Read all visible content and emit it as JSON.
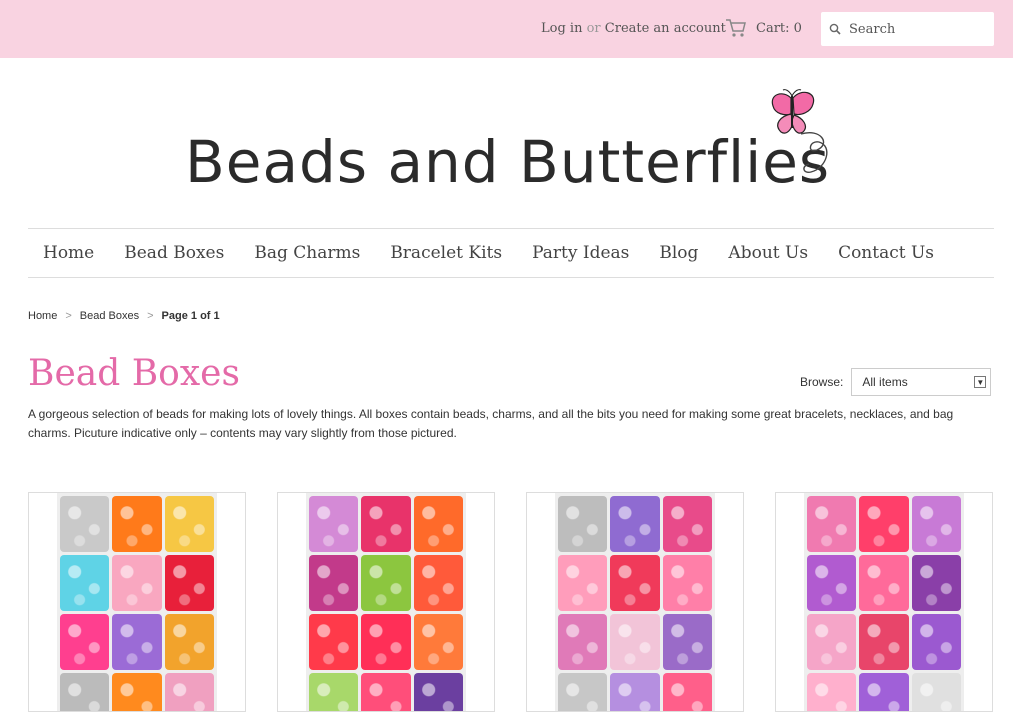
{
  "header": {
    "login_label": "Log in",
    "or_label": "or",
    "create_account_label": "Create an account",
    "cart_label": "Cart: 0",
    "search_placeholder": "Search"
  },
  "logo": {
    "text": "Beads and Butterflies"
  },
  "nav": {
    "items": [
      "Home",
      "Bead Boxes",
      "Bag Charms",
      "Bracelet Kits",
      "Party Ideas",
      "Blog",
      "About Us",
      "Contact Us"
    ]
  },
  "breadcrumb": {
    "home": "Home",
    "section": "Bead Boxes",
    "current": "Page 1 of 1",
    "separator": ">"
  },
  "page": {
    "title": "Bead Boxes",
    "browse_label": "Browse:",
    "browse_value": "All items",
    "description": "A gorgeous selection of beads for making lots of lovely things. All boxes contain beads, charms, and all the bits you need for making some great bracelets, necklaces, and bag charms. Picuture indicative only – contents may vary slightly from those pictured."
  },
  "colors": {
    "topbar": "#f9d3e1",
    "accent": "#e46aa8",
    "product_palettes": [
      [
        "#c9c9c9",
        "#ff7a1a",
        "#f6c744",
        "#5fd3e6",
        "#f9a7c0",
        "#e8203a",
        "#ff3f8f",
        "#9b6bd6",
        "#f2a32c",
        "#bbbbbb",
        "#ff8a1e",
        "#f0a0c0"
      ],
      [
        "#d48ad6",
        "#e8336a",
        "#ff6a2a",
        "#c23a8a",
        "#8cc63f",
        "#ff5a3a",
        "#ff3a4a",
        "#ff2f57",
        "#ff7a3a",
        "#a8d86a",
        "#ff4e7a",
        "#6b3fa0"
      ],
      [
        "#bdbdbd",
        "#8f6bd1",
        "#e84b8a",
        "#ff9dbb",
        "#f03a5a",
        "#ff7fa8",
        "#e07ab8",
        "#f2c4d8",
        "#9a6bc8",
        "#c7c7c7",
        "#b58fe0",
        "#ff5f8a"
      ],
      [
        "#f07ab0",
        "#ff3f6a",
        "#c87ad6",
        "#b15bd0",
        "#ff6a9a",
        "#8a3fa8",
        "#f5a5c8",
        "#e8456a",
        "#9b59d0",
        "#ffb0cd",
        "#a060d8",
        "#e0e0e0"
      ]
    ]
  }
}
